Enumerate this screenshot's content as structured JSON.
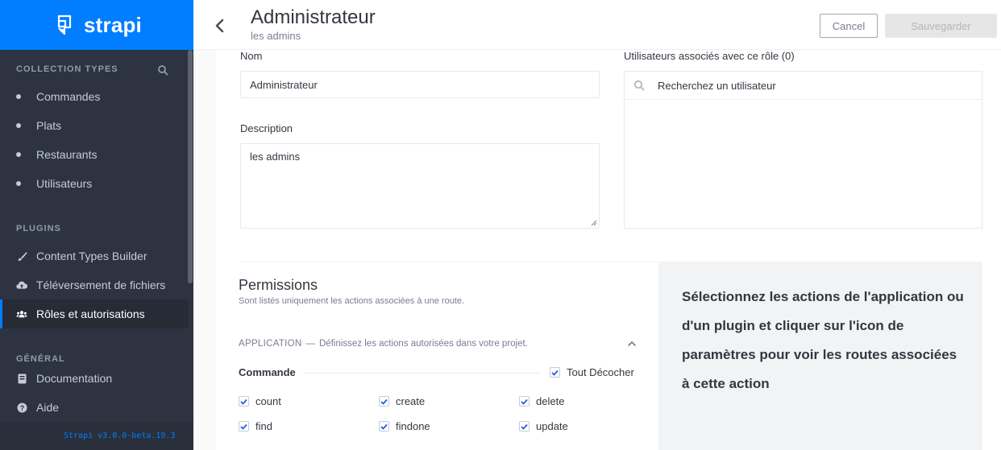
{
  "brand": {
    "name": "strapi"
  },
  "sidebar": {
    "collection_title": "Collection Types",
    "collection_items": [
      {
        "label": "Commandes"
      },
      {
        "label": "Plats"
      },
      {
        "label": "Restaurants"
      },
      {
        "label": "Utilisateurs"
      }
    ],
    "plugins_title": "Plugins",
    "plugin_items": [
      {
        "label": "Content Types Builder",
        "icon": "brush-icon"
      },
      {
        "label": "Téléversement de fichiers",
        "icon": "cloud-upload-icon"
      },
      {
        "label": "Rôles et autorisations",
        "icon": "users-icon",
        "active": true
      }
    ],
    "general_title": "Général",
    "general_items": [
      {
        "label": "Documentation",
        "icon": "book-icon"
      },
      {
        "label": "Aide",
        "icon": "question-circle-icon"
      }
    ],
    "version": "Strapi v3.0.0-beta.19.3"
  },
  "header": {
    "title": "Administrateur",
    "subtitle": "les admins",
    "cancel_label": "Cancel",
    "save_label": "Sauvegarder"
  },
  "form": {
    "name_label": "Nom",
    "name_value": "Administrateur",
    "description_label": "Description",
    "description_value": "les admins",
    "users_label": "Utilisateurs associés avec ce rôle (0)",
    "users_search_placeholder": "Recherchez un utilisateur"
  },
  "permissions": {
    "title": "Permissions",
    "subtitle": "Sont listés uniquement les actions associées à une route.",
    "application_label": "Application",
    "application_desc": "Définissez les actions autorisées dans votre projet.",
    "group_name": "Commande",
    "toggle_all_label": "Tout Décocher",
    "actions": [
      {
        "label": "count",
        "checked": true
      },
      {
        "label": "create",
        "checked": true
      },
      {
        "label": "delete",
        "checked": true
      },
      {
        "label": "find",
        "checked": true
      },
      {
        "label": "findone",
        "checked": true
      },
      {
        "label": "update",
        "checked": true
      }
    ]
  },
  "info": {
    "text": "Sélectionnez les actions de l'application ou d'un plugin et cliquer sur l'icon de paramètres pour voir les routes associées à cette action"
  },
  "colors": {
    "accent": "#007eff",
    "sidebar_bg": "#2d3340"
  }
}
